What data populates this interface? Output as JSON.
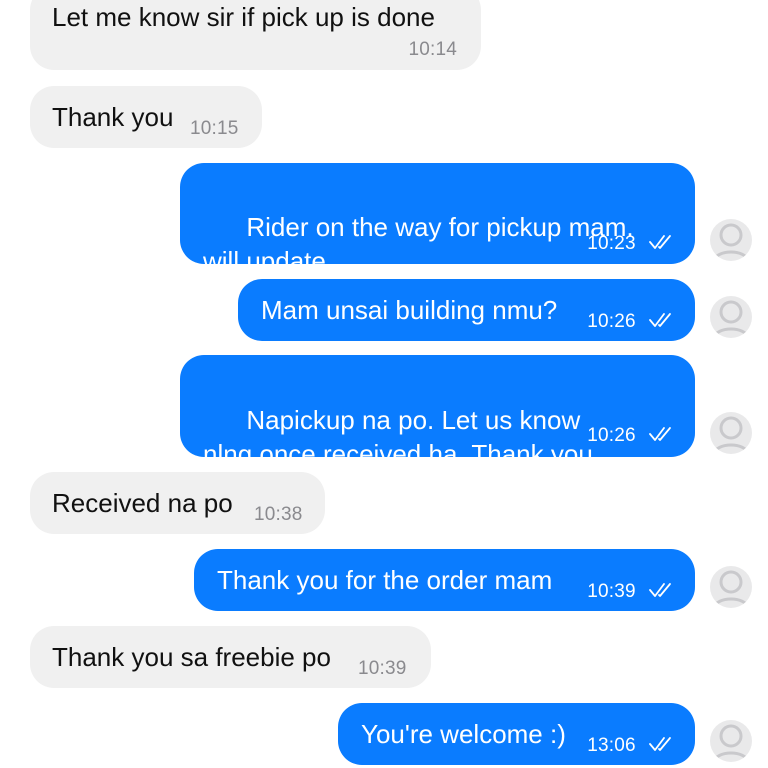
{
  "messages": [
    {
      "direction": "incoming",
      "text": "Let me know sir if pick up is done",
      "time": "10:14"
    },
    {
      "direction": "incoming",
      "text": "Thank you",
      "time": "10:15"
    },
    {
      "direction": "outgoing",
      "text": "Rider on the way for pickup mam. will update.",
      "time": "10:23",
      "status": "seen"
    },
    {
      "direction": "outgoing",
      "text": "Mam unsai building nmu?",
      "time": "10:26",
      "status": "seen"
    },
    {
      "direction": "outgoing",
      "text": "Napickup na po. Let us know nlng once received ha. Thank you.",
      "time": "10:26",
      "status": "seen"
    },
    {
      "direction": "incoming",
      "text": "Received na po",
      "time": "10:38"
    },
    {
      "direction": "outgoing",
      "text": "Thank you for the order mam",
      "time": "10:39",
      "status": "seen"
    },
    {
      "direction": "incoming",
      "text": "Thank you sa freebie po",
      "time": "10:39"
    },
    {
      "direction": "outgoing",
      "text": "You're welcome :)",
      "time": "13:06",
      "status": "seen"
    }
  ],
  "icons": {
    "read_receipt": "double-check-icon",
    "avatar": "user-avatar-icon"
  },
  "colors": {
    "outgoing_bubble": "#0a7cff",
    "incoming_bubble": "#f0f0f0",
    "incoming_text": "#111111",
    "timestamp_incoming": "#8a8a8e"
  }
}
